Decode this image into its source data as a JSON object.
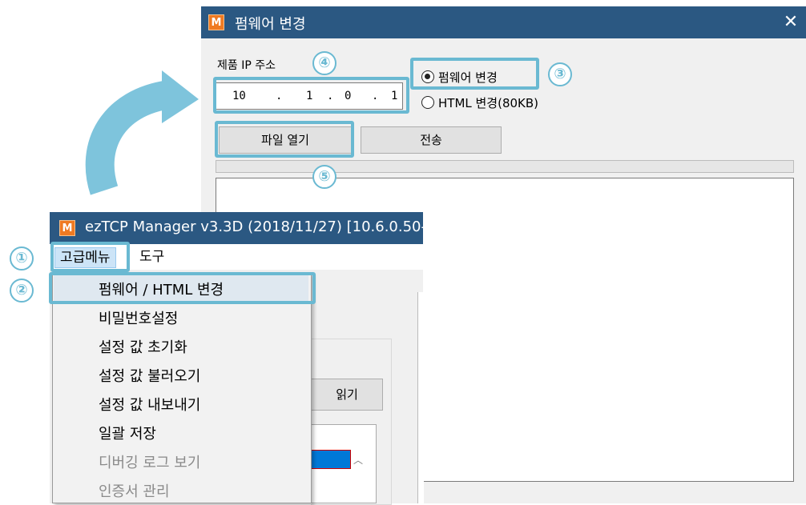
{
  "firmware_dialog": {
    "title": "펌웨어 변경",
    "close_glyph": "✕",
    "ip_label": "제품 IP 주소",
    "ip_octets": [
      "10",
      "1",
      "0",
      "1"
    ],
    "ip_separator": ".",
    "radio_options": [
      {
        "label": "펌웨어 변경",
        "selected": true
      },
      {
        "label": "HTML 변경(80KB)",
        "selected": false
      }
    ],
    "open_file_label": "파일 열기",
    "send_label": "전송"
  },
  "manager_window": {
    "icon_text": "M",
    "title": "ezTCP Manager v3.3D (2018/11/27) [10.6.0.50-",
    "menu": [
      "고급메뉴",
      "도구"
    ],
    "read_button_label": "읽기",
    "dropdown_items": [
      {
        "label": "펌웨어 / HTML 변경",
        "enabled": true
      },
      {
        "label": "비밀번호설정",
        "enabled": true
      },
      {
        "label": "설정 값 초기화",
        "enabled": true
      },
      {
        "label": "설정 값 불러오기",
        "enabled": true
      },
      {
        "label": "설정 값 내보내기",
        "enabled": true
      },
      {
        "label": "일괄 저장",
        "enabled": true
      },
      {
        "label": "디버깅 로그 보기",
        "enabled": false
      },
      {
        "label": "인증서 관리",
        "enabled": false
      }
    ]
  },
  "callouts": [
    "①",
    "②",
    "③",
    "④",
    "⑤"
  ],
  "colors": {
    "titlebar": "#2b5882",
    "highlight": "#6ab9d2",
    "app_icon": "#ef7a22"
  }
}
